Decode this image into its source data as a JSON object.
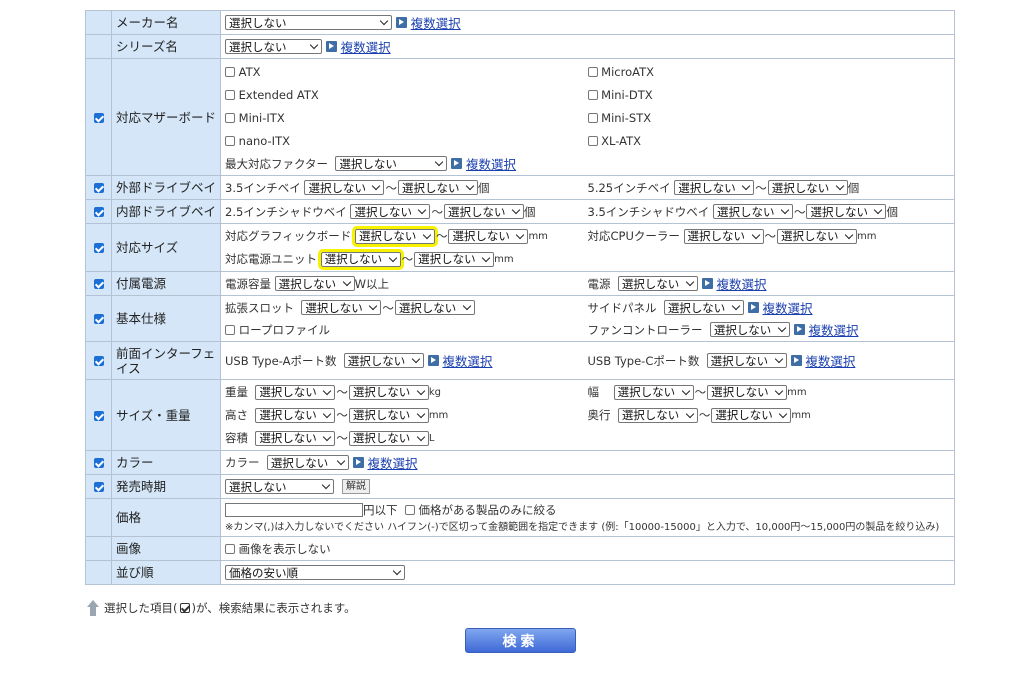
{
  "default_select": "選択しない",
  "multi_select": "複数選択",
  "tilde": "〜",
  "rows": {
    "maker": {
      "label": "メーカー名"
    },
    "series": {
      "label": "シリーズ名"
    },
    "mb": {
      "label": "対応マザーボード",
      "options": [
        "ATX",
        "MicroATX",
        "Extended ATX",
        "Mini-DTX",
        "Mini-ITX",
        "Mini-STX",
        "nano-ITX",
        "XL-ATX"
      ],
      "max_factor": "最大対応ファクター"
    },
    "ext_bay": {
      "label": "外部ドライブベイ",
      "a": "3.5インチベイ",
      "b": "5.25インチベイ",
      "unit": "個"
    },
    "int_bay": {
      "label": "内部ドライブベイ",
      "a": "2.5インチシャドウベイ",
      "b": "3.5インチシャドウベイ",
      "unit": "個"
    },
    "size_support": {
      "label": "対応サイズ",
      "gpu": "対応グラフィックボード",
      "cpu_cooler": "対応CPUクーラー",
      "psu": "対応電源ユニット",
      "unit": "mm"
    },
    "psu": {
      "label": "付属電源",
      "capacity": "電源容量",
      "capacity_unit": "W以上",
      "psu_label": "電源"
    },
    "basic": {
      "label": "基本仕様",
      "slot": "拡張スロット",
      "side_panel": "サイドパネル",
      "low_profile": "ロープロファイル",
      "fan_ctrl": "ファンコントローラー"
    },
    "front": {
      "label": "前面インターフェイス",
      "usb_a": "USB Type-Aポート数",
      "usb_c": "USB Type-Cポート数"
    },
    "size_weight": {
      "label": "サイズ・重量",
      "weight": "重量",
      "weight_unit": "kg",
      "width": "幅",
      "height": "高さ",
      "depth": "奥行",
      "volume": "容積",
      "mm": "mm",
      "volume_unit": "L"
    },
    "color": {
      "label": "カラー",
      "field": "カラー"
    },
    "release": {
      "label": "発売時期",
      "kaisetsu": "解説"
    },
    "price": {
      "label": "価格",
      "below": "円以下",
      "only_priced": "価格がある製品のみに絞る",
      "note": "※カンマ(,)は入力しないでください ハイフン(-)で区切って金額範囲を指定できます (例:「10000-15000」と入力で、10,000円〜15,000円の製品を絞り込み)"
    },
    "image": {
      "label": "画像",
      "hide": "画像を表示しない"
    },
    "sort": {
      "label": "並び順",
      "value": "価格の安い順"
    }
  },
  "hint": {
    "before": "選択した項目(",
    "after": ")が、検索結果に表示されます。"
  },
  "search_button": "検索",
  "colors": {
    "label_bg": "#d4e6f7",
    "border": "#b3c3d4",
    "highlight": "#f6f200",
    "link": "#1a3fae",
    "button": "#3f69d6"
  }
}
